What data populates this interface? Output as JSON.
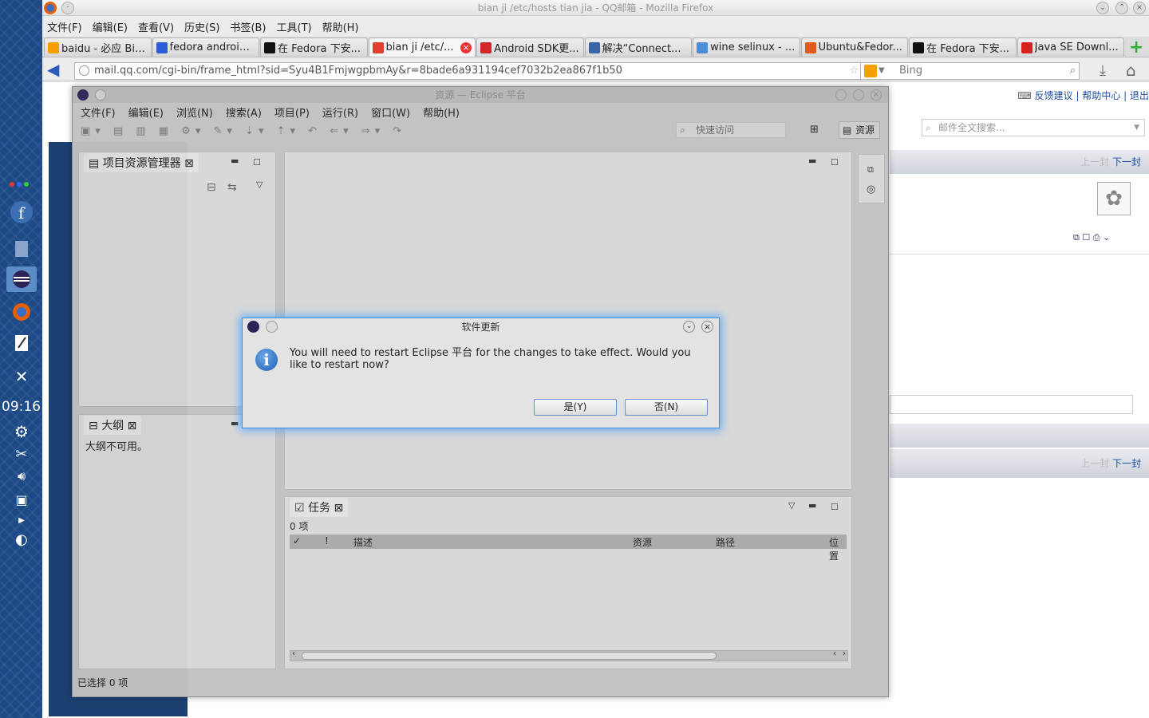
{
  "dock": {
    "time": "09:16"
  },
  "firefox": {
    "window_title": "bian ji /etc/hosts tian jia - QQ邮箱 - Mozilla Firefox",
    "menu": [
      "文件(F)",
      "编辑(E)",
      "查看(V)",
      "历史(S)",
      "书签(B)",
      "工具(T)",
      "帮助(H)"
    ],
    "tabs": [
      {
        "label": "baidu - 必应 Bing",
        "color": "#f5a000"
      },
      {
        "label": "fedora android...",
        "color": "#2a5cd8"
      },
      {
        "label": "在 Fedora 下安...",
        "color": "#111111"
      },
      {
        "label": "bian ji /etc/...",
        "color": "#e04030"
      },
      {
        "label": "Android SDK更...",
        "color": "#d02828"
      },
      {
        "label": "解决“Connect...",
        "color": "#3a64a8"
      },
      {
        "label": "wine selinux - ...",
        "color": "#4a8ed8"
      },
      {
        "label": "Ubuntu&Fedor...",
        "color": "#e05a1a"
      },
      {
        "label": "在 Fedora 下安...",
        "color": "#111111"
      },
      {
        "label": "Java SE Downl...",
        "color": "#d82020"
      }
    ],
    "url": "mail.qq.com/cgi-bin/frame_html?sid=Syu4B1FmjwgpbmAy&r=8bade6a931194cef7032b2ea867f1b50",
    "search_engine": "Bing"
  },
  "qqmail": {
    "top_links": "反馈建议 | 帮助中心 | 退出",
    "search_placeholder": "邮件全文搜索...",
    "prev": "上一封",
    "next": "下一封"
  },
  "eclipse": {
    "title": "资源 — Eclipse 平台",
    "menu": [
      "文件(F)",
      "编辑(E)",
      "浏览(N)",
      "搜索(A)",
      "项目(P)",
      "运行(R)",
      "窗口(W)",
      "帮助(H)"
    ],
    "quick_access": "快速访问",
    "perspective": "资源",
    "project_explorer": "项目资源管理器",
    "outline": "大纲",
    "outline_msg": "大纲不可用。",
    "tasks": "任务",
    "tasks_count": "0 项",
    "task_columns": [
      "✓",
      "!",
      "描述",
      "资源",
      "路径",
      "位置"
    ],
    "status": "已选择 0 项"
  },
  "dialog": {
    "title": "软件更新",
    "message": "You will need to restart Eclipse 平台 for the changes to take effect. Would you like to restart now?",
    "yes": "是(Y)",
    "no": "否(N)"
  }
}
